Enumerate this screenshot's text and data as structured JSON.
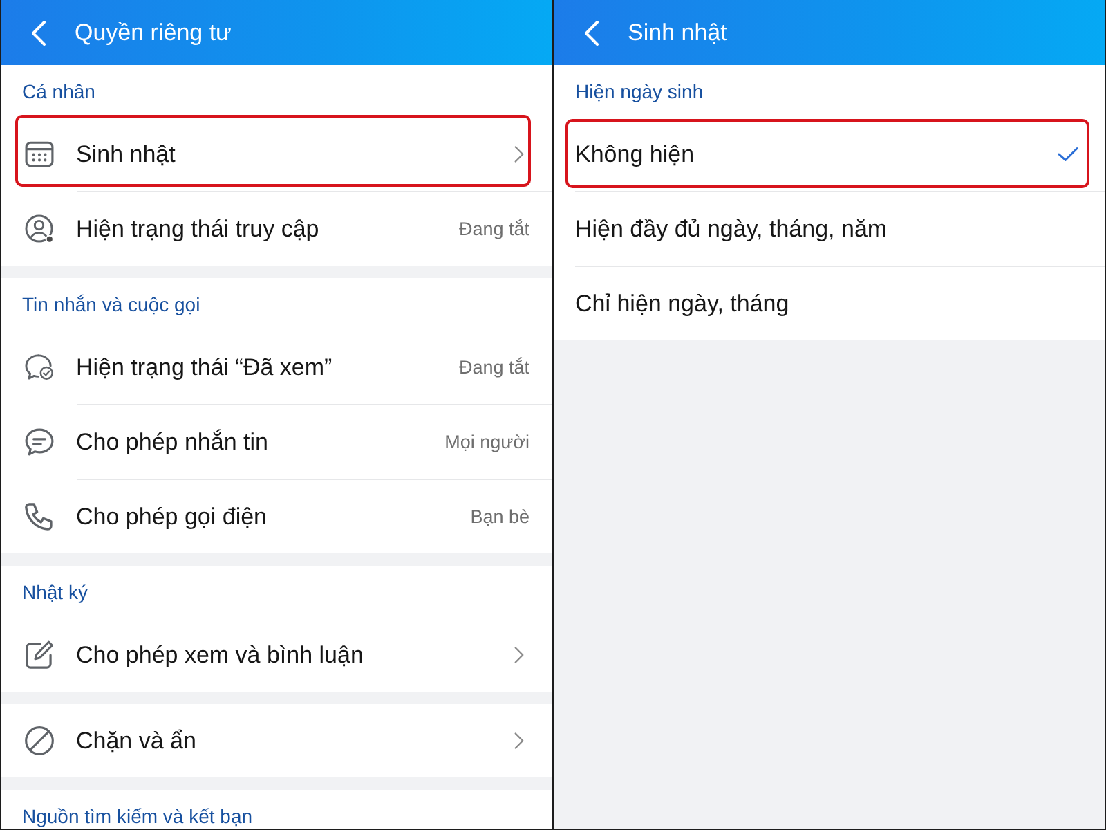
{
  "screens": [
    {
      "header": {
        "title": "Quyền riêng tư"
      },
      "sections": [
        {
          "title": "Cá nhân",
          "items": [
            {
              "kind": "link",
              "label": "Sinh nhật",
              "highlighted": true
            },
            {
              "kind": "setting",
              "label": "Hiện trạng thái truy cập",
              "value": "Đang tắt",
              "highlighted": false
            }
          ]
        },
        {
          "title": "Tin nhắn và cuộc gọi",
          "items": [
            {
              "kind": "setting",
              "label": "Hiện trạng thái “Đã xem”",
              "value": "Đang tắt",
              "highlighted": false
            },
            {
              "kind": "setting",
              "label": "Cho phép nhắn tin",
              "value": "Mọi người",
              "highlighted": false
            },
            {
              "kind": "setting",
              "label": "Cho phép gọi điện",
              "value": "Bạn bè",
              "highlighted": false
            }
          ]
        },
        {
          "title": "Nhật ký",
          "items": [
            {
              "kind": "link",
              "label": "Cho phép xem và bình luận",
              "highlighted": false
            }
          ]
        },
        {
          "items": [
            {
              "kind": "link",
              "label": "Chặn và ẩn",
              "highlighted": false
            }
          ]
        },
        {
          "title": "Nguồn tìm kiếm và kết bạn"
        }
      ]
    },
    {
      "header": {
        "title": "Sinh nhật"
      },
      "sections": [
        {
          "title": "Hiện ngày sinh",
          "items": [
            {
              "kind": "option",
              "label": "Không hiện",
              "selected": true,
              "highlighted": true
            },
            {
              "kind": "option",
              "label": "Hiện đầy đủ ngày, tháng, năm",
              "selected": false,
              "highlighted": false
            },
            {
              "kind": "option",
              "label": "Chỉ hiện ngày, tháng",
              "selected": false,
              "highlighted": false
            }
          ]
        }
      ]
    }
  ]
}
